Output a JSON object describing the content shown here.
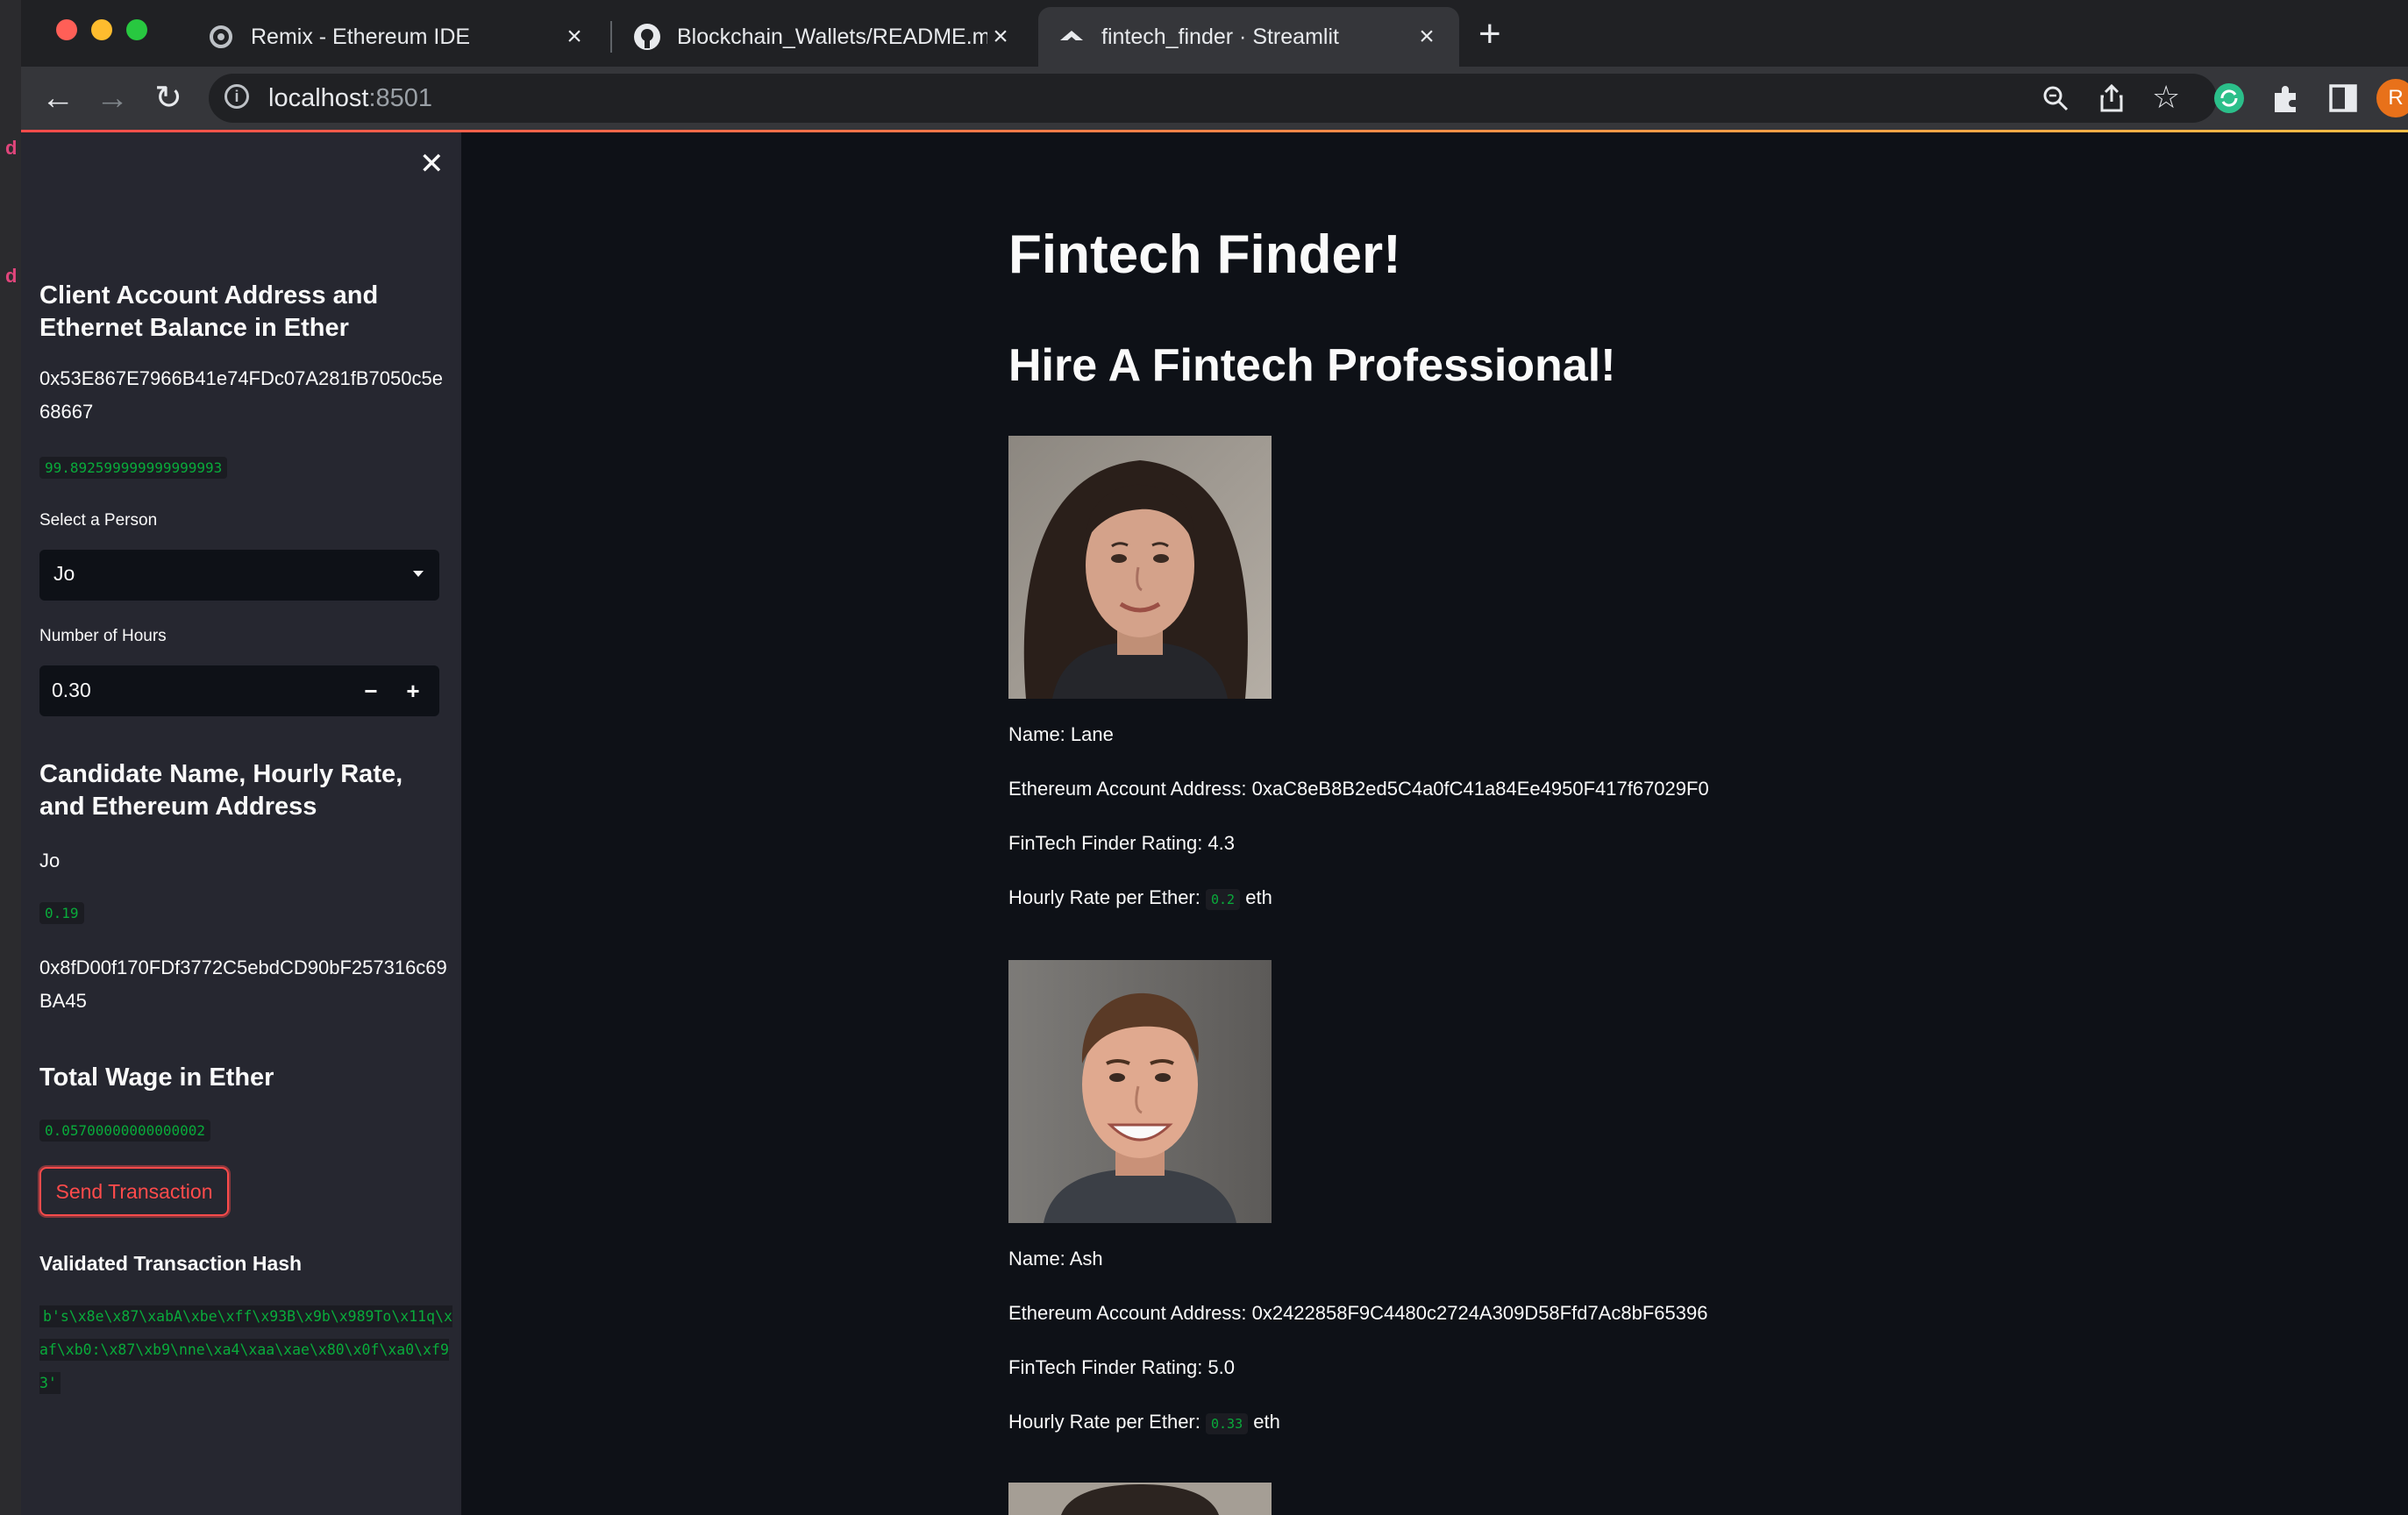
{
  "browser": {
    "tabs": [
      {
        "title": "Remix - Ethereum IDE",
        "active": false
      },
      {
        "title": "Blockchain_Wallets/README.md",
        "active": false
      },
      {
        "title": "fintech_finder · Streamlit",
        "active": true
      }
    ],
    "address": {
      "host": "localhost",
      "port": ":8501"
    },
    "profile_initial": "R",
    "new_tab_label": "+"
  },
  "sidebar": {
    "account_heading": "Client Account Address and Ethernet Balance in Ether",
    "account_address": "0x53E867E7966B41e74FDc07A281fB7050c5e68667",
    "balance": "99.892599999999999993",
    "select_person_label": "Select a Person",
    "selected_person": "Jo",
    "hours_label": "Number of Hours",
    "hours_value": "0.30",
    "candidate_heading": "Candidate Name, Hourly Rate, and Ethereum Address",
    "candidate_name": "Jo",
    "candidate_rate": "0.19",
    "candidate_address": "0x8fD00f170FDf3772C5ebdCD90bF257316c69BA45",
    "wage_heading": "Total Wage in Ether",
    "wage_value": "0.05700000000000002",
    "send_button": "Send Transaction",
    "hash_heading": "Validated Transaction Hash",
    "hash_value": "b's\\x8e\\x87\\xabA\\xbe\\xff\\x93B\\x9b\\x989To\\x11q\\xaf\\xb0:\\x87\\xb9\\nne\\xa4\\xaa\\xae\\x80\\x0f\\xa0\\xf93'"
  },
  "main": {
    "title": "Fintech Finder!",
    "subtitle": "Hire A Fintech Professional!",
    "candidates": [
      {
        "name": "Name: Lane",
        "address": "Ethereum Account Address: 0xaC8eB8B2ed5C4a0fC41a84Ee4950F417f67029F0",
        "rating": "FinTech Finder Rating: 4.3",
        "rate_label": "Hourly Rate per Ether:",
        "rate": "0.2",
        "unit": "eth"
      },
      {
        "name": "Name: Ash",
        "address": "Ethereum Account Address: 0x2422858F9C4480c2724A309D58Ffd7Ac8bF65396",
        "rating": "FinTech Finder Rating: 5.0",
        "rate_label": "Hourly Rate per Ether:",
        "rate": "0.33",
        "unit": "eth"
      }
    ]
  },
  "colors": {
    "accent": "#ff4b4b",
    "code_green": "#09ab3b",
    "bg": "#0e1117",
    "sidebar_bg": "#262730"
  }
}
